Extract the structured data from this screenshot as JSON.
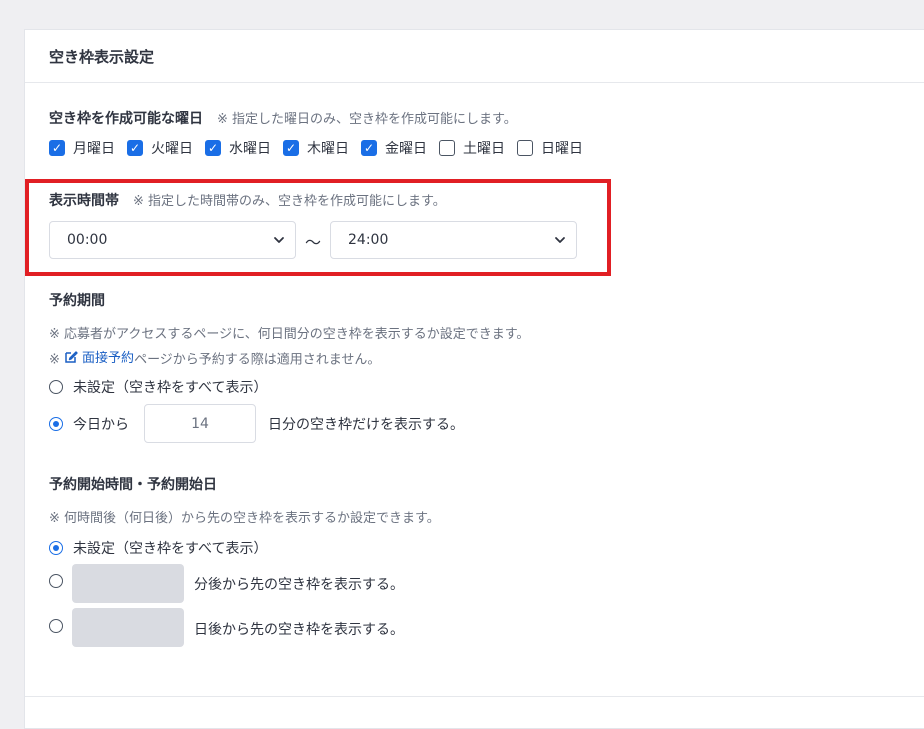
{
  "panel": {
    "title": "空き枠表示設定"
  },
  "weekdays": {
    "title": "空き枠を作成可能な曜日",
    "note": "※ 指定した曜日のみ、空き枠を作成可能にします。",
    "days": [
      {
        "label": "月曜日",
        "checked": true
      },
      {
        "label": "火曜日",
        "checked": true
      },
      {
        "label": "水曜日",
        "checked": true
      },
      {
        "label": "木曜日",
        "checked": true
      },
      {
        "label": "金曜日",
        "checked": true
      },
      {
        "label": "土曜日",
        "checked": false
      },
      {
        "label": "日曜日",
        "checked": false
      }
    ]
  },
  "time_range": {
    "title": "表示時間帯",
    "note": "※ 指定した時間帯のみ、空き枠を作成可能にします。",
    "start": "00:00",
    "separator": "〜",
    "end": "24:00",
    "highlight_color": "#e11f24"
  },
  "booking_period": {
    "title": "予約期間",
    "note1": "※ 応募者がアクセスするページに、何日間分の空き枠を表示するか設定できます。",
    "note2_prefix": "※",
    "note2_link": "面接予約",
    "note2_suffix": "ページから予約する際は適用されません。",
    "option_unset": "未設定（空き枠をすべて表示）",
    "option_from_today": "今日から",
    "days_value": "14",
    "option_suffix": "日分の空き枠だけを表示する。",
    "selected": "from_today"
  },
  "booking_start": {
    "title": "予約開始時間・予約開始日",
    "note": "※ 何時間後（何日後）から先の空き枠を表示するか設定できます。",
    "option_unset": "未設定（空き枠をすべて表示）",
    "option_minutes": "分後から先の空き枠を表示する。",
    "option_days": "日後から先の空き枠を表示する。",
    "selected": "unset"
  },
  "colors": {
    "accent": "#1a6ee6",
    "link": "#1a5fc4"
  }
}
